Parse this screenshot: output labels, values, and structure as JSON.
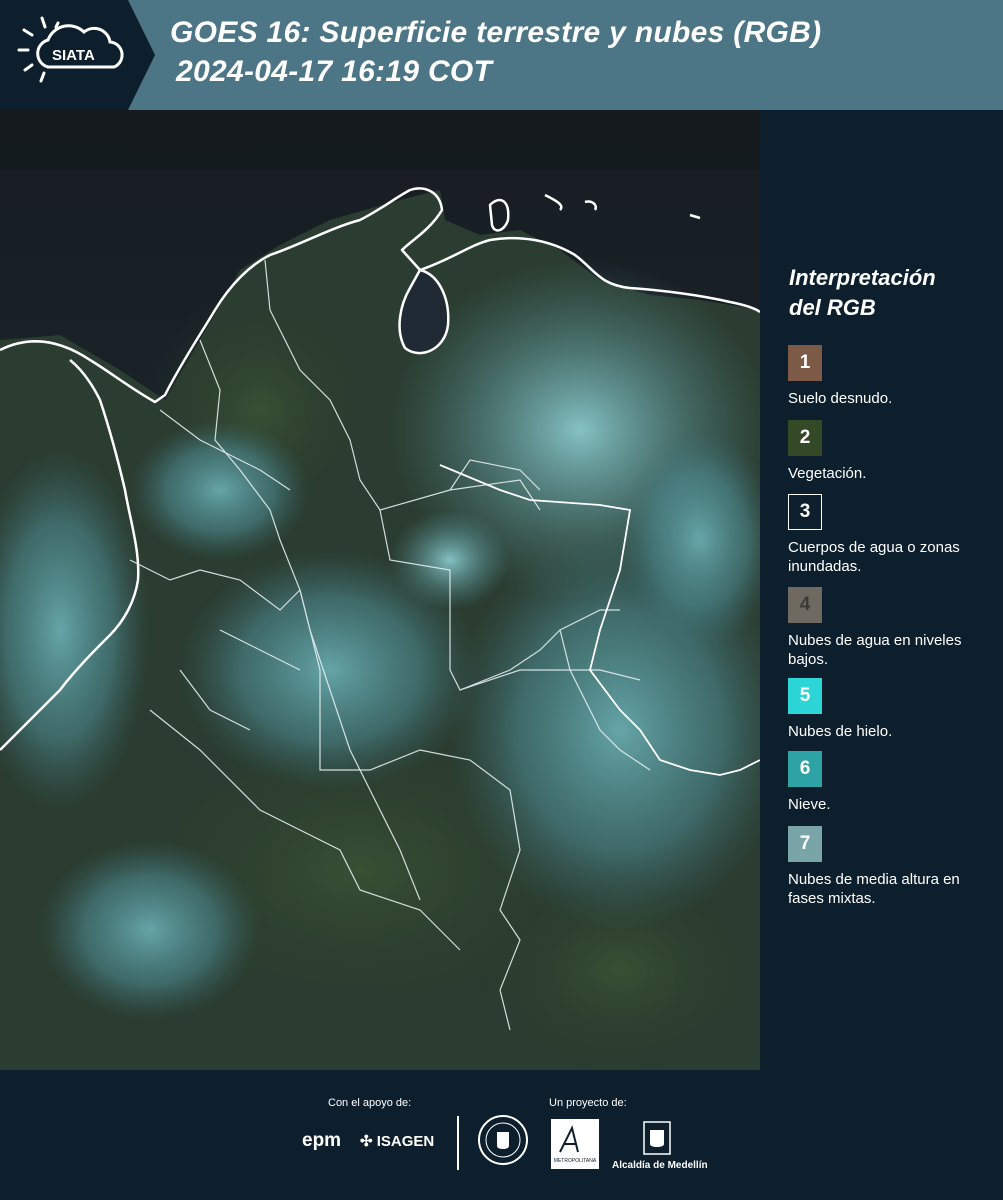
{
  "header": {
    "logo_text": "SIATA",
    "title_line1": "GOES 16: Superficie terrestre y nubes (RGB)",
    "title_line2": "2024-04-17 16:19 COT",
    "background_color": "#4c7585",
    "logo_tab_color": "#0d1f2d"
  },
  "map": {
    "icon": "satellite-map-image"
  },
  "legend": {
    "title_line1": "Interpretación",
    "title_line2": "del RGB",
    "items": [
      {
        "number": "1",
        "color": "#7d5a47",
        "description": "Suelo desnudo."
      },
      {
        "number": "2",
        "color": "#344a27",
        "description": "Vegetación."
      },
      {
        "number": "3",
        "color": "#0d1f2d",
        "description": "Cuerpos de agua o zonas inundadas."
      },
      {
        "number": "4",
        "color": "#6e6a62",
        "description": "Nubes de agua en niveles bajos."
      },
      {
        "number": "5",
        "color": "#2dd6d6",
        "description": "Nubes de hielo."
      },
      {
        "number": "6",
        "color": "#2ea3a6",
        "description": "Nieve."
      },
      {
        "number": "7",
        "color": "#7aa5a8",
        "description": "Nubes de media altura en fases mixtas."
      }
    ]
  },
  "footer": {
    "support_label": "Con el apoyo de:",
    "project_label": "Un proyecto de:",
    "epm": "epm",
    "isagen": "ISAGEN",
    "metropolitana_text": "METROPOLITANA",
    "alcaldia": "Alcaldía de Medellín"
  }
}
